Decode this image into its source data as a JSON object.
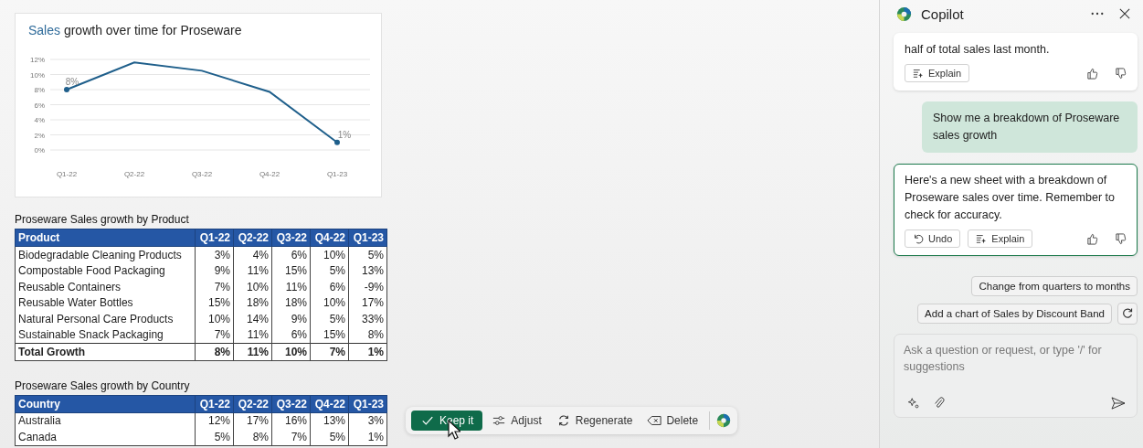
{
  "chart": {
    "chart_data": {
      "type": "line",
      "title": "Sales growth over time for Proseware",
      "categories": [
        "Q1-22",
        "Q2-22",
        "Q3-22",
        "Q4-22",
        "Q1-23"
      ],
      "series": [
        {
          "color": "#1f5f8b",
          "values": [
            8,
            11.6,
            10.5,
            7.7,
            1
          ]
        }
      ],
      "grid": true,
      "ylim": [
        0,
        12
      ],
      "yticks": [
        {
          "value": 0,
          "label": "0%"
        },
        {
          "value": 2,
          "label": "2%"
        },
        {
          "value": 4,
          "label": "4%"
        },
        {
          "value": 6,
          "label": "6%"
        },
        {
          "value": 8,
          "label": "8%"
        },
        {
          "value": 10,
          "label": "10%"
        },
        {
          "value": 12,
          "label": "12%"
        }
      ],
      "annotations": [
        {
          "x": "Q1-22",
          "y": 8,
          "text": "8%"
        },
        {
          "x": "Q1-23",
          "y": 1,
          "text": "1%"
        }
      ]
    }
  },
  "tables": [
    {
      "title": "Proseware Sales growth by Product",
      "columns": [
        "Product",
        "Q1-22",
        "Q2-22",
        "Q3-22",
        "Q4-22",
        "Q1-23"
      ],
      "rows": [
        {
          "kind": "data",
          "cells": [
            "Biodegradable Cleaning Products",
            "3%",
            "4%",
            "6%",
            "10%",
            "5%"
          ]
        },
        {
          "kind": "data",
          "cells": [
            "Compostable Food Packaging",
            "9%",
            "11%",
            "15%",
            "5%",
            "13%"
          ]
        },
        {
          "kind": "data",
          "cells": [
            "Reusable Containers",
            "7%",
            "10%",
            "11%",
            "6%",
            "-9%"
          ]
        },
        {
          "kind": "data",
          "cells": [
            "Reusable Water Bottles",
            "15%",
            "18%",
            "18%",
            "10%",
            "17%"
          ]
        },
        {
          "kind": "data",
          "cells": [
            "Natural Personal Care Products",
            "10%",
            "14%",
            "9%",
            "5%",
            "33%"
          ]
        },
        {
          "kind": "data",
          "cells": [
            "Sustainable Snack Packaging",
            "7%",
            "11%",
            "6%",
            "15%",
            "8%"
          ]
        },
        {
          "kind": "total",
          "cells": [
            "Total Growth",
            "8%",
            "11%",
            "10%",
            "7%",
            "1%"
          ]
        }
      ]
    },
    {
      "title": "Proseware Sales growth by Country",
      "columns": [
        "Country",
        "Q1-22",
        "Q2-22",
        "Q3-22",
        "Q4-22",
        "Q1-23"
      ],
      "rows": [
        {
          "kind": "data",
          "cells": [
            "Australia",
            "12%",
            "17%",
            "16%",
            "13%",
            "3%"
          ]
        },
        {
          "kind": "data",
          "cells": [
            "Canada",
            "5%",
            "8%",
            "7%",
            "5%",
            "1%"
          ]
        }
      ]
    }
  ],
  "toolbar": {
    "buttons": [
      {
        "kind": "keep",
        "label": "Keep it"
      },
      {
        "kind": "adjust",
        "label": "Adjust"
      },
      {
        "kind": "regenerate",
        "label": "Regenerate"
      },
      {
        "kind": "delete",
        "label": "Delete"
      }
    ]
  },
  "copilot": {
    "title": "Copilot",
    "messages": [
      {
        "kind": "assistant",
        "highlighted": false,
        "text": "half of total sales last month.",
        "actions": [
          {
            "kind": "explain",
            "label": "Explain"
          }
        ]
      },
      {
        "kind": "user",
        "text": "Show me a breakdown of Proseware sales growth"
      },
      {
        "kind": "assistant",
        "highlighted": true,
        "text": "Here's a new sheet with a breakdown of Proseware sales over time. Remember to check for accuracy.",
        "actions": [
          {
            "kind": "undo",
            "label": "Undo"
          },
          {
            "kind": "explain",
            "label": "Explain"
          }
        ]
      }
    ],
    "suggestions": [
      "Change from quarters to months",
      "Add a chart of Sales by Discount Band"
    ],
    "input": {
      "placeholder": "Ask a question or request, or type '/' for suggestions"
    }
  }
}
